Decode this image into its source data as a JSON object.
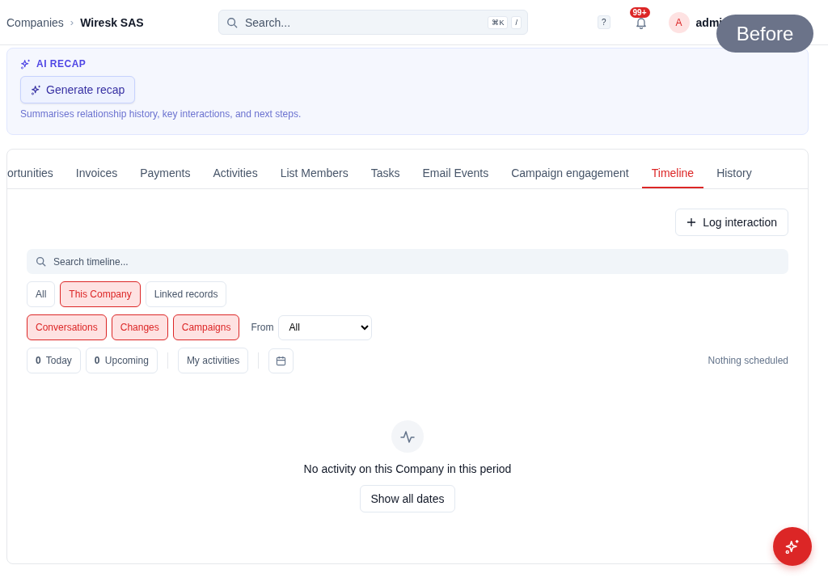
{
  "breadcrumb": {
    "parent": "Companies",
    "separator": "›",
    "current": "Wiresk SAS"
  },
  "search": {
    "placeholder": "Search...",
    "shortcuts": [
      "⌘K",
      "/"
    ]
  },
  "header": {
    "help": "?",
    "notifications": "99+",
    "avatar": "A",
    "user": "admi"
  },
  "overlay_label": "Before",
  "ai_recap": {
    "title": "AI RECAP",
    "button": "Generate recap",
    "description": "Summarises relationship history, key interactions, and next steps."
  },
  "tabs": [
    {
      "label": "ortunities",
      "selected": false
    },
    {
      "label": "Invoices",
      "selected": false
    },
    {
      "label": "Payments",
      "selected": false
    },
    {
      "label": "Activities",
      "selected": false
    },
    {
      "label": "List Members",
      "selected": false
    },
    {
      "label": "Tasks",
      "selected": false
    },
    {
      "label": "Email Events",
      "selected": false
    },
    {
      "label": "Campaign engagement",
      "selected": false
    },
    {
      "label": "Timeline",
      "selected": true
    },
    {
      "label": "History",
      "selected": false
    }
  ],
  "log_button": "Log interaction",
  "timeline_search": {
    "placeholder": "Search timeline..."
  },
  "scope_filters": [
    {
      "label": "All",
      "selected": false
    },
    {
      "label": "This Company",
      "selected": true
    },
    {
      "label": "Linked records",
      "selected": false
    }
  ],
  "type_filters": [
    {
      "label": "Conversations",
      "selected": true
    },
    {
      "label": "Changes",
      "selected": true
    },
    {
      "label": "Campaigns",
      "selected": true
    }
  ],
  "from": {
    "label": "From",
    "value": "All"
  },
  "counters": [
    {
      "count": "0",
      "label": "Today"
    },
    {
      "count": "0",
      "label": "Upcoming"
    }
  ],
  "my_activities": "My activities",
  "schedule_status": "Nothing scheduled",
  "empty_state": {
    "message": "No activity on this Company in this period",
    "button": "Show all dates"
  }
}
